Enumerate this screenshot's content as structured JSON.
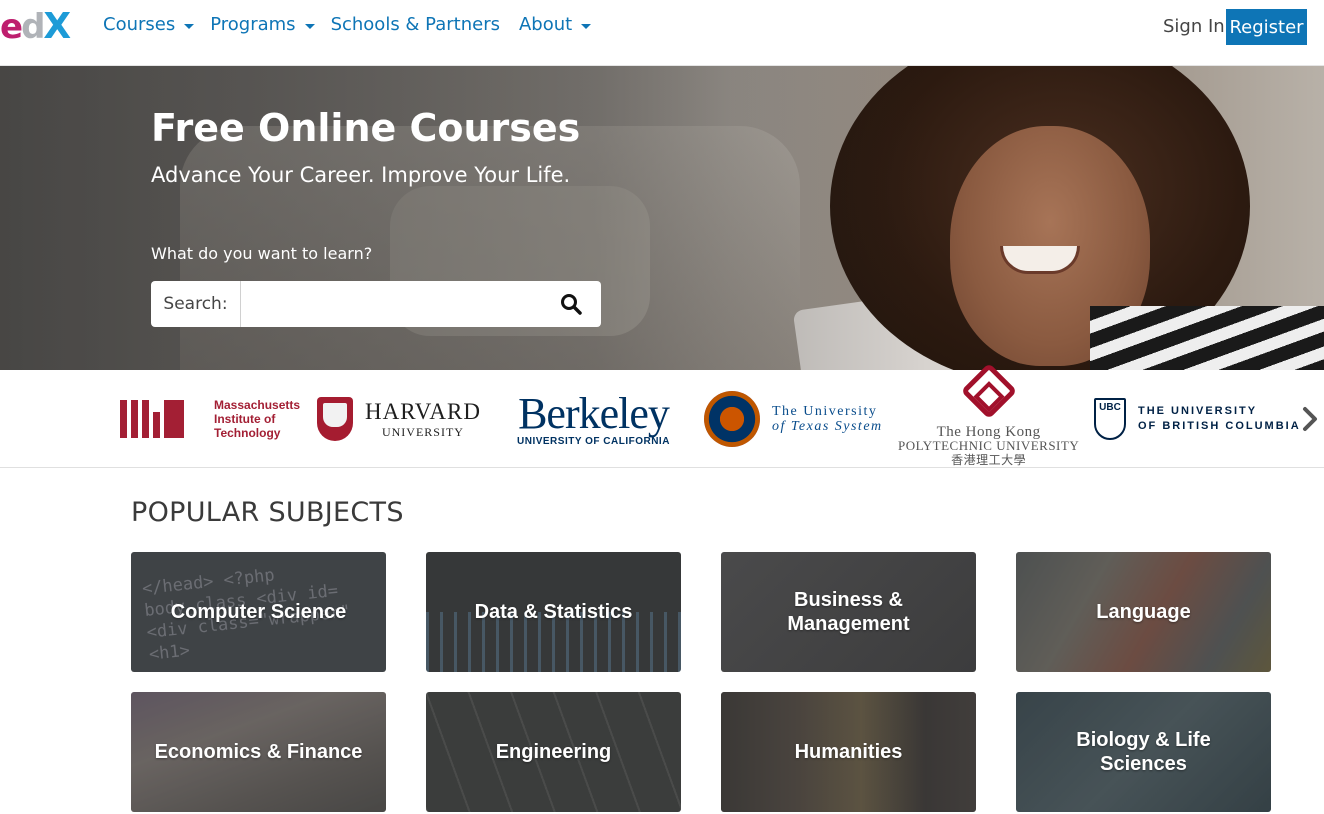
{
  "header": {
    "logo": {
      "e": "e",
      "d": "d",
      "x": "X"
    },
    "nav": [
      {
        "label": "Courses",
        "has_dropdown": true
      },
      {
        "label": "Programs",
        "has_dropdown": true
      },
      {
        "label": "Schools & Partners",
        "has_dropdown": false
      },
      {
        "label": "About",
        "has_dropdown": true
      }
    ],
    "sign_in": "Sign In",
    "register": "Register"
  },
  "hero": {
    "title": "Free Online Courses",
    "subtitle": "Advance Your Career. Improve Your Life.",
    "prompt": "What do you want to learn?",
    "search_label": "Search:",
    "search_value": "",
    "search_placeholder": ""
  },
  "partners": {
    "mit": {
      "line1": "Massachusetts",
      "line2": "Institute of",
      "line3": "Technology"
    },
    "harvard": {
      "line1": "HARVARD",
      "line2": "UNIVERSITY"
    },
    "berkeley": {
      "line1": "Berkeley",
      "line2": "UNIVERSITY OF CALIFORNIA"
    },
    "texas": {
      "line1": "The University",
      "line2": "of Texas System"
    },
    "polyu": {
      "line1": "The Hong Kong",
      "line2": "Polytechnic University",
      "line3": "香港理工大學"
    },
    "ubc": {
      "crest": "UBC",
      "line1": "THE UNIVERSITY",
      "line2": "OF BRITISH COLUMBIA"
    }
  },
  "subjects": {
    "title": "POPULAR SUBJECTS",
    "items": [
      {
        "label": "Computer Science"
      },
      {
        "label": "Data & Statistics"
      },
      {
        "label": "Business & Management"
      },
      {
        "label": "Language"
      },
      {
        "label": "Economics & Finance"
      },
      {
        "label": "Engineering"
      },
      {
        "label": "Humanities"
      },
      {
        "label": "Biology & Life Sciences"
      }
    ]
  },
  "colors": {
    "brand_blue": "#0e75b6",
    "edx_magenta": "#be1e6e",
    "edx_cyan": "#1d9bd7"
  }
}
